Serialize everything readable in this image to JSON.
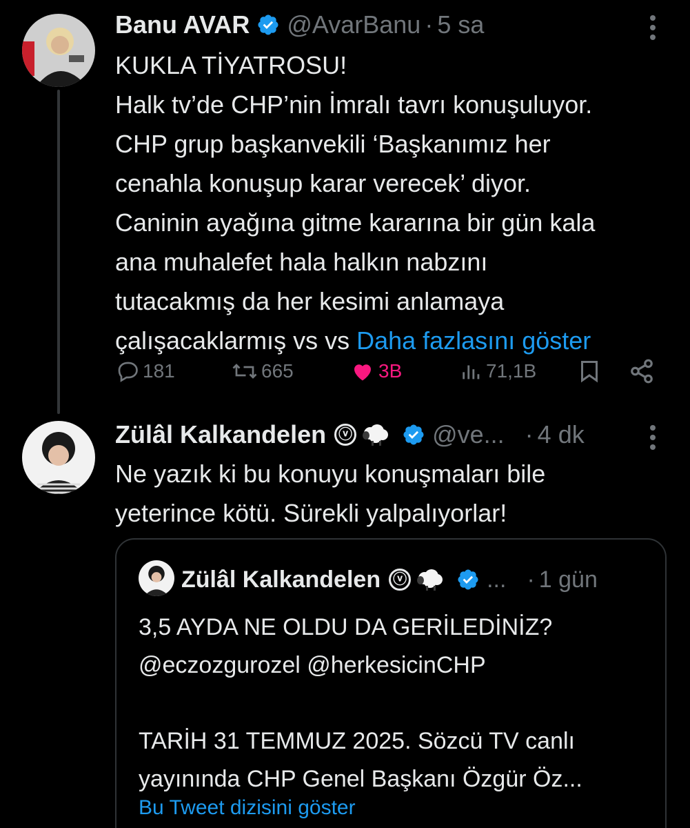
{
  "tweet1": {
    "name": "Banu AVAR",
    "handle": "@AvarBanu",
    "separator": "·",
    "time": "5 sa",
    "text": "KUKLA TİYATROSU!\nHalk tv’de CHP’nin İmralı tavrı konuşuluyor.\nCHP grup başkanvekili  ‘Başkanımız her\ncenahla konuşup karar verecek’ diyor.\nCaninin ayağına gitme kararına bir gün kala\nana muhalefet hala halkın nabzını\ntutacakmış da  her kesimi anlamaya\nçalışacaklarmış vs vs ",
    "show_more": "Daha fazlasını göster",
    "replies": "181",
    "retweets": "665",
    "likes": "3B",
    "views": "71,1B",
    "like_color": "#f91880",
    "icons": [
      "verified-badge-icon",
      "more-icon",
      "reply-icon",
      "retweet-icon",
      "heart-icon",
      "views-icon",
      "bookmark-icon",
      "share-icon"
    ]
  },
  "tweet2": {
    "name": "Zülâl Kalkandelen",
    "name_symbol": "ⓥ",
    "handle": "@ve...",
    "separator": "·",
    "time": "4 dk",
    "text": "Ne yazık ki bu konuyu konuşmaları bile\nyeterince kötü. Sürekli yalpalıyorlar!"
  },
  "quote": {
    "name": "Zülâl Kalkandelen",
    "name_symbol": "ⓥ",
    "handle": "...",
    "separator": "·",
    "time": "1 gün",
    "text": "3,5 AYDA NE OLDU DA GERİLEDİNİZ?\n@eczozgurozel @herkesicinCHP\n\nTARİH 31 TEMMUZ 2025. Sözcü TV canlı\nyayınında CHP Genel Başkanı Özgür Öz...",
    "show_thread": "Bu Tweet dizisini göster"
  },
  "colors": {
    "background": "#000000",
    "text": "#e7e9ea",
    "muted": "#71767b",
    "link": "#1d9bf0",
    "verified": "#1d9bf0"
  }
}
